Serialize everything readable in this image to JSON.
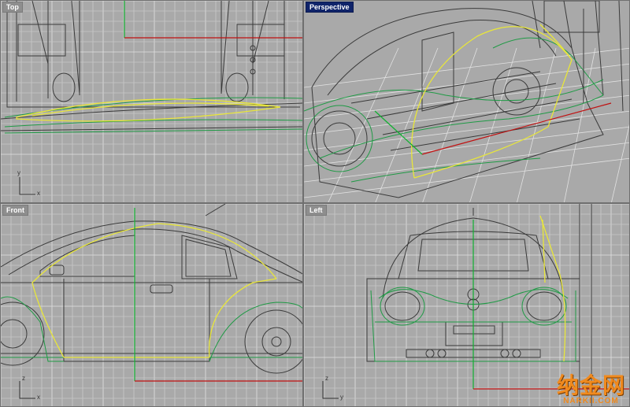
{
  "viewports": {
    "top": {
      "label": "Top",
      "active": false
    },
    "perspective": {
      "label": "Perspective",
      "active": true
    },
    "front": {
      "label": "Front",
      "active": false
    },
    "left": {
      "label": "Left",
      "active": false
    }
  },
  "axes": {
    "top": {
      "x": "x",
      "y": "y"
    },
    "front": {
      "x": "x",
      "y": "z"
    },
    "left": {
      "x": "y",
      "y": "z"
    }
  },
  "colors": {
    "grid": "#c9c9c9",
    "grid_major": "#e2e2e2",
    "wire": "#3a3a3a",
    "curve_yellow": "#e8e63a",
    "curve_green": "#1f9a45",
    "axis_red": "#c01010",
    "axis_green": "#10b030",
    "active_label": "#10246a",
    "watermark": "#f08a1e"
  },
  "watermark": {
    "chinese": "纳金网",
    "latin": "NARKII.COM"
  }
}
